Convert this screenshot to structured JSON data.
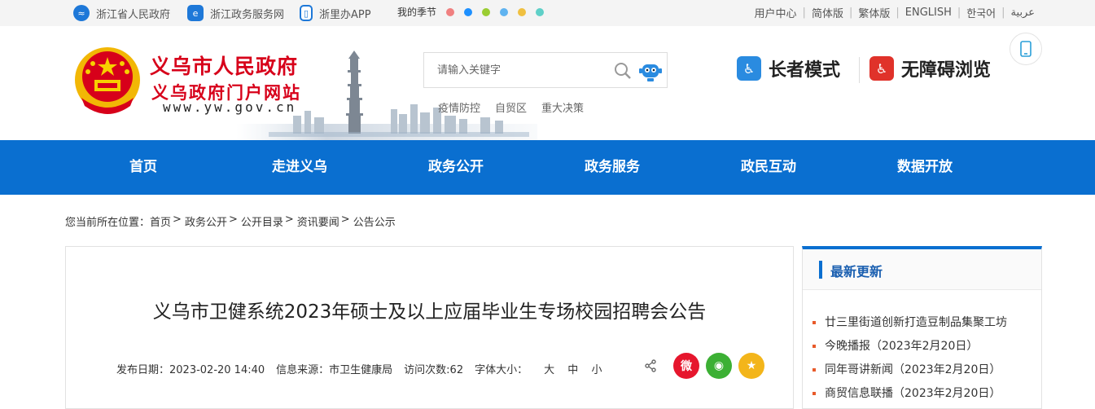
{
  "topbar": {
    "links": [
      {
        "label": "浙江省人民政府",
        "icon": "zhejiang-gov-icon"
      },
      {
        "label": "浙江政务服务网",
        "icon": "gov-service-icon"
      },
      {
        "label": "浙里办APP",
        "icon": "mobile-app-icon"
      }
    ],
    "season_label": "我的季节",
    "season_colors": [
      "#f08080",
      "#1e90ff",
      "#9acd32",
      "#5fb3f0",
      "#f0c040",
      "#5fd0c8"
    ],
    "languages": [
      "用户中心",
      "简体版",
      "繁体版",
      "ENGLISH",
      "한국어",
      "عربية"
    ]
  },
  "header": {
    "site_name": "义乌市人民政府",
    "site_subtitle": "义乌政府门户网站",
    "site_url": "www.yw.gov.cn",
    "search_placeholder": "请输入关键字",
    "hot_words": [
      "疫情防控",
      "自贸区",
      "重大决策"
    ],
    "elder_mode": "长者模式",
    "accessible_mode": "无障碍浏览"
  },
  "nav": {
    "items": [
      "首页",
      "走进义乌",
      "政务公开",
      "政务服务",
      "政民互动",
      "数据开放"
    ],
    "color": "#0a6fd0"
  },
  "breadcrumb": {
    "prefix": "您当前所在位置：",
    "items": [
      "首页",
      "政务公开",
      "公开目录",
      "资讯要闻",
      "公告公示"
    ]
  },
  "article": {
    "title": "义乌市卫健系统2023年硕士及以上应届毕业生专场校园招聘会公告",
    "publish_date": "发布日期：2023-02-20 14:40",
    "source": "信息来源：市卫生健康局",
    "views": "访问次数:62",
    "font_size_label": "字体大小：",
    "font_sizes": [
      "大",
      "中",
      "小"
    ]
  },
  "sidebar": {
    "title": "最新更新",
    "news": [
      "廿三里街道创新打造豆制品集聚工坊",
      "今晚播报（2023年2月20日）",
      "同年哥讲新闻（2023年2月20日）",
      "商贸信息联播（2023年2月20日）"
    ]
  }
}
